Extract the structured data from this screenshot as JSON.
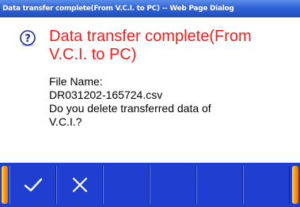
{
  "window": {
    "title": "Data transfer complete(From V.C.I. to PC) -- Web Page Dialog"
  },
  "dialog": {
    "icon": "question-icon",
    "headline_line1": "Data transfer complete(From",
    "headline_line2": "V.C.I. to PC)",
    "file_name_label": "File Name:",
    "file_name": "DR031202-165724.csv",
    "question_line1": "Do you delete transferred data of",
    "question_line2": "V.C.I.?",
    "headline_color": "#ff1a1a"
  },
  "toolbar": {
    "buttons": [
      {
        "icon": "checkmark-icon"
      },
      {
        "icon": "close-icon"
      },
      {
        "icon": "empty"
      },
      {
        "icon": "empty"
      },
      {
        "icon": "empty"
      },
      {
        "icon": "empty"
      }
    ],
    "background_color": "#1f3fd2",
    "accent_color": "#ff9a00"
  }
}
